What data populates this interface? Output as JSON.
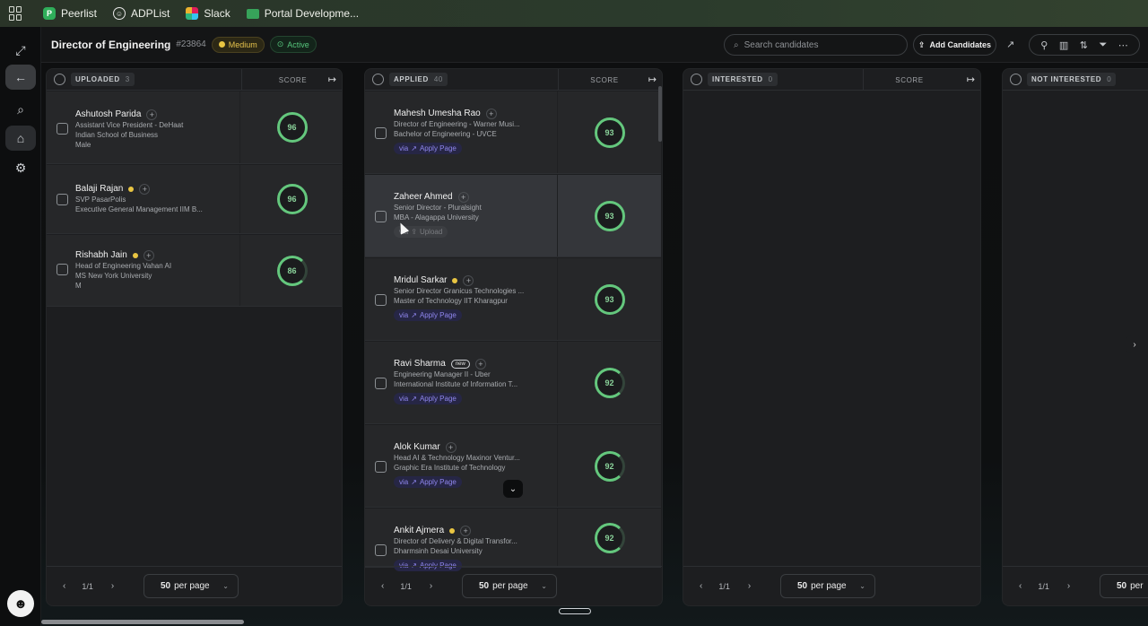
{
  "bookmarks": {
    "items": [
      {
        "label": "Peerlist",
        "icon": "peerlist-icon"
      },
      {
        "label": "ADPList",
        "icon": "adplist-icon"
      },
      {
        "label": "Slack",
        "icon": "slack-icon"
      },
      {
        "label": "Portal Developme...",
        "icon": "portal-icon"
      }
    ]
  },
  "header": {
    "title": "Director of Engineering",
    "job_id": "#23864",
    "priority": "Medium",
    "status": "Active",
    "search_placeholder": "Search candidates",
    "add_label": "Add Candidates"
  },
  "columns": [
    {
      "label": "UPLOADED",
      "count": "3",
      "score_label": "SCORE",
      "candidates": [
        {
          "name": "Ashutosh Parida",
          "lines": [
            "Assistant Vice President - DeHaat",
            "Indian School of Business",
            "Male"
          ],
          "score": "96",
          "dot": false
        },
        {
          "name": "Balaji Rajan",
          "lines": [
            "SVP PasarPolis",
            "Executive General Management IIM B..."
          ],
          "score": "96",
          "dot": true
        },
        {
          "name": "Rishabh Jain",
          "lines": [
            "Head of Engineering Vahan AI",
            "MS New York University",
            "M"
          ],
          "score": "86",
          "dot": true
        }
      ],
      "pagination": {
        "page": "1/1",
        "per_page_num": "50",
        "per_page_text": "per page"
      }
    },
    {
      "label": "APPLIED",
      "count": "40",
      "score_label": "SCORE",
      "candidates": [
        {
          "name": "Mahesh Umesha Rao",
          "lines": [
            "Director of Engineering - Warner Musi...",
            "Bachelor of Engineering - UVCE"
          ],
          "score": "93",
          "via": "via",
          "source": "Apply Page"
        },
        {
          "name": "Zaheer Ahmed",
          "lines": [
            "Senior Director - Pluralsight",
            "MBA - Alagappa University"
          ],
          "score": "93",
          "via": "via",
          "source": "Upload"
        },
        {
          "name": "Mridul Sarkar",
          "lines": [
            "Senior Director Granicus Technologies ...",
            "Master of Technology IIT Kharagpur"
          ],
          "score": "93",
          "via": "via",
          "source": "Apply Page",
          "dot": true
        },
        {
          "name": "Ravi Sharma",
          "badge": "new",
          "lines": [
            "Engineering Manager II - Uber",
            "International Institute of Information T..."
          ],
          "score": "92",
          "via": "via",
          "source": "Apply Page"
        },
        {
          "name": "Alok Kumar",
          "lines": [
            "Head AI & Technology Maxinor Ventur...",
            "Graphic Era Institute of Technology"
          ],
          "score": "92",
          "via": "via",
          "source": "Apply Page"
        },
        {
          "name": "Ankit Ajmera",
          "lines": [
            "Director of Delivery & Digital Transfor...",
            "Dharmsinh Desai University"
          ],
          "score": "92",
          "via": "via",
          "source": "Apply Page",
          "dot": true
        }
      ],
      "pagination": {
        "page": "1/1",
        "per_page_num": "50",
        "per_page_text": "per page"
      }
    },
    {
      "label": "INTERESTED",
      "count": "0",
      "score_label": "SCORE",
      "pagination": {
        "page": "1/1",
        "per_page_num": "50",
        "per_page_text": "per page"
      }
    },
    {
      "label": "NOT INTERESTED",
      "count": "0",
      "pagination": {
        "page": "1/1",
        "per_page_num": "50",
        "per_page_text": "per"
      }
    }
  ],
  "colors": {
    "accent_green": "#64c77d",
    "medium": "#e9c542",
    "via_purple": "#8f86ee"
  }
}
